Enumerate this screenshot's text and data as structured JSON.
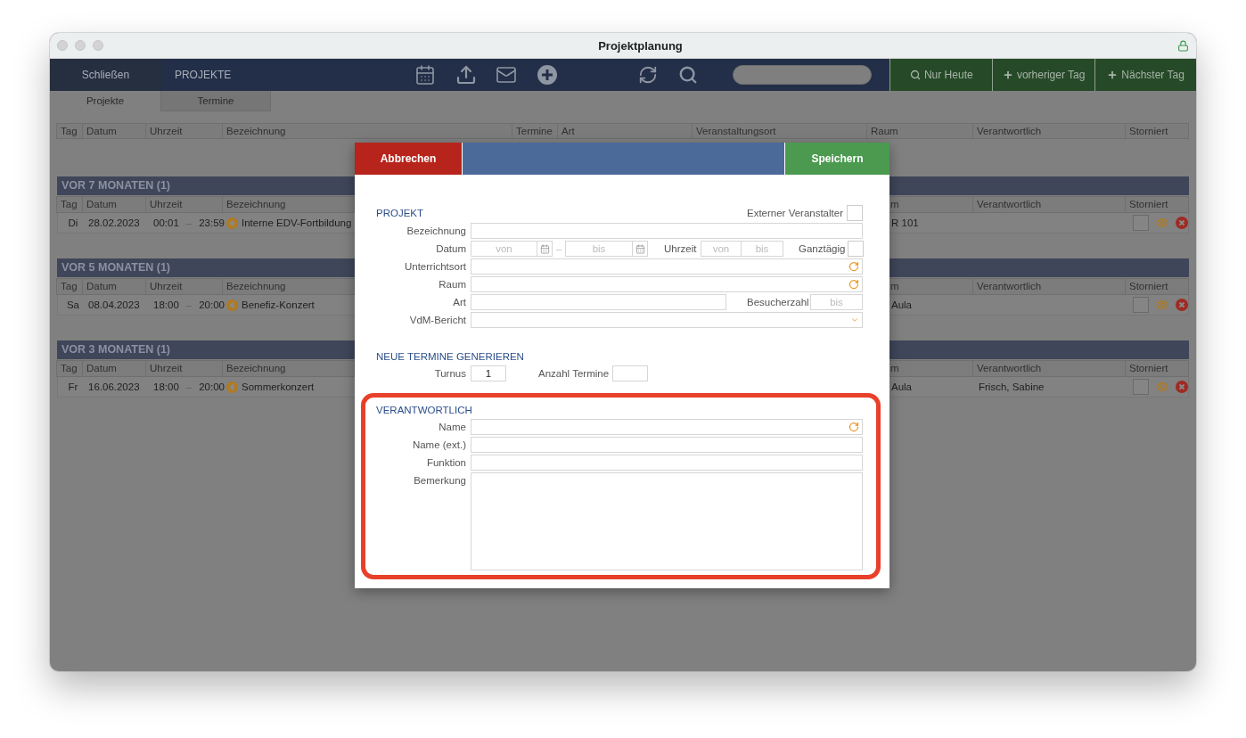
{
  "window": {
    "title": "Projektplanung"
  },
  "toolbar": {
    "close_button": "Schließen",
    "section": "PROJEKTE",
    "day_buttons": [
      {
        "label": "Nur Heute"
      },
      {
        "label": "vorheriger Tag"
      },
      {
        "label": "Nächster Tag"
      }
    ]
  },
  "tabs": [
    {
      "label": "Projekte",
      "selected": true
    },
    {
      "label": "Termine",
      "selected": false
    }
  ],
  "table": {
    "columns": [
      "Tag",
      "Datum",
      "Uhrzeit",
      "Bezeichnung",
      "Termine",
      "Art",
      "Veranstaltungsort",
      "Raum",
      "Verantwortlich",
      "Storniert"
    ]
  },
  "groups": [
    {
      "title": "VOR 7 MONATEN (1)",
      "columns": [
        "Tag",
        "Datum",
        "Uhrzeit",
        "Bezeichnung",
        "m",
        "Verantwortlich",
        "Storniert"
      ],
      "rows": [
        {
          "day": "Di",
          "date": "28.02.2023",
          "from": "00:01",
          "separator": "–",
          "to": "23:59",
          "name": "Interne EDV-Fortbildung",
          "room": "R 101",
          "cancelled": false
        }
      ]
    },
    {
      "title": "VOR 5 MONATEN (1)",
      "columns": [
        "Tag",
        "Datum",
        "Uhrzeit",
        "Bezeichnung",
        "m",
        "Verantwortlich",
        "Storniert"
      ],
      "rows": [
        {
          "day": "Sa",
          "date": "08.04.2023",
          "from": "18:00",
          "separator": "–",
          "to": "20:00",
          "name": "Benefiz-Konzert",
          "room": "Aula",
          "cancelled": false
        }
      ]
    },
    {
      "title": "VOR 3 MONATEN (1)",
      "columns": [
        "Tag",
        "Datum",
        "Uhrzeit",
        "Bezeichnung",
        "m",
        "Verantwortlich",
        "Storniert"
      ],
      "rows": [
        {
          "day": "Fr",
          "date": "16.06.2023",
          "from": "18:00",
          "separator": "–",
          "to": "20:00",
          "name": "Sommerkonzert",
          "room": "Aula",
          "responsible": "Frisch, Sabine",
          "cancelled": false
        }
      ]
    }
  ],
  "dialog": {
    "cancel_button": "Abbrechen",
    "save_button": "Speichern",
    "sections": [
      {
        "title": "PROJEKT",
        "highlighted": false,
        "option": {
          "label": "Externer Veranstalter",
          "checked": false
        },
        "rows": [
          {
            "kind": "text",
            "label": "Bezeichnung"
          },
          {
            "kind": "date",
            "label": "Datum",
            "from_placeholder": "von",
            "separator": "–",
            "to_placeholder": "bis",
            "time_label": "Uhrzeit",
            "time_from_placeholder": "von",
            "time_to_placeholder": "bis",
            "all_day": {
              "label": "Ganztägig",
              "checked": false
            }
          },
          {
            "kind": "lookup",
            "label": "Unterrichtsort"
          },
          {
            "kind": "lookup",
            "label": "Raum"
          },
          {
            "kind": "type",
            "label": "Art",
            "visitors_label": "Besucherzahl",
            "visitors_placeholder": "bis"
          },
          {
            "kind": "select",
            "label": "VdM-Bericht"
          }
        ]
      },
      {
        "title": "NEUE TERMINE GENERIEREN",
        "highlighted": false,
        "rows": [
          {
            "kind": "interval",
            "label": "Turnus",
            "value": "1",
            "count_label": "Anzahl Termine"
          }
        ]
      },
      {
        "title": "VERANTWORTLICH",
        "highlighted": true,
        "rows": [
          {
            "kind": "lookup",
            "label": "Name"
          },
          {
            "kind": "text",
            "label": "Name (ext.)"
          },
          {
            "kind": "text",
            "label": "Funktion"
          },
          {
            "kind": "textarea",
            "label": "Bemerkung"
          }
        ]
      }
    ]
  }
}
